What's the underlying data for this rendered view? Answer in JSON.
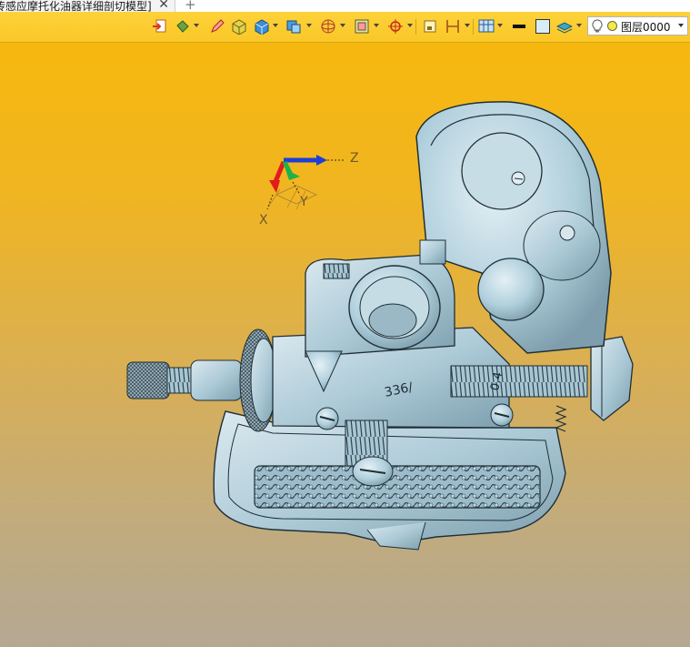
{
  "tab": {
    "title": "传感应摩托化油器详细剖切模型]",
    "close_glyph": "✕",
    "new_tab_glyph": "+"
  },
  "toolbar": {
    "tools": [
      "import-icon",
      "paint-bucket-icon",
      "pencil-icon",
      "shaded-box-icon",
      "solid-box-icon",
      "box-dropdown-icon",
      "sphere-wireframe-icon",
      "frame-icon",
      "target-icon",
      "clip-icon",
      "h-measure-icon",
      "view-grid-icon",
      "black-rect-icon",
      "color-swatch-icon",
      "layers-icon"
    ],
    "layer": {
      "name": "图层0000",
      "bulb_icon": "lightbulb-icon",
      "color": "#f5e94a"
    }
  },
  "viewport": {
    "background_top": "#f6b80f",
    "background_bottom": "#b5a893",
    "model_color": "#b3cfdb",
    "triad": {
      "labels": {
        "x": "X",
        "y": "Y",
        "z": "Z"
      },
      "colors": {
        "x": "#e21b1b",
        "y": "#1fb14a",
        "z": "#1d3fd8"
      }
    },
    "model_engravings": [
      "336/",
      "0.4"
    ]
  }
}
